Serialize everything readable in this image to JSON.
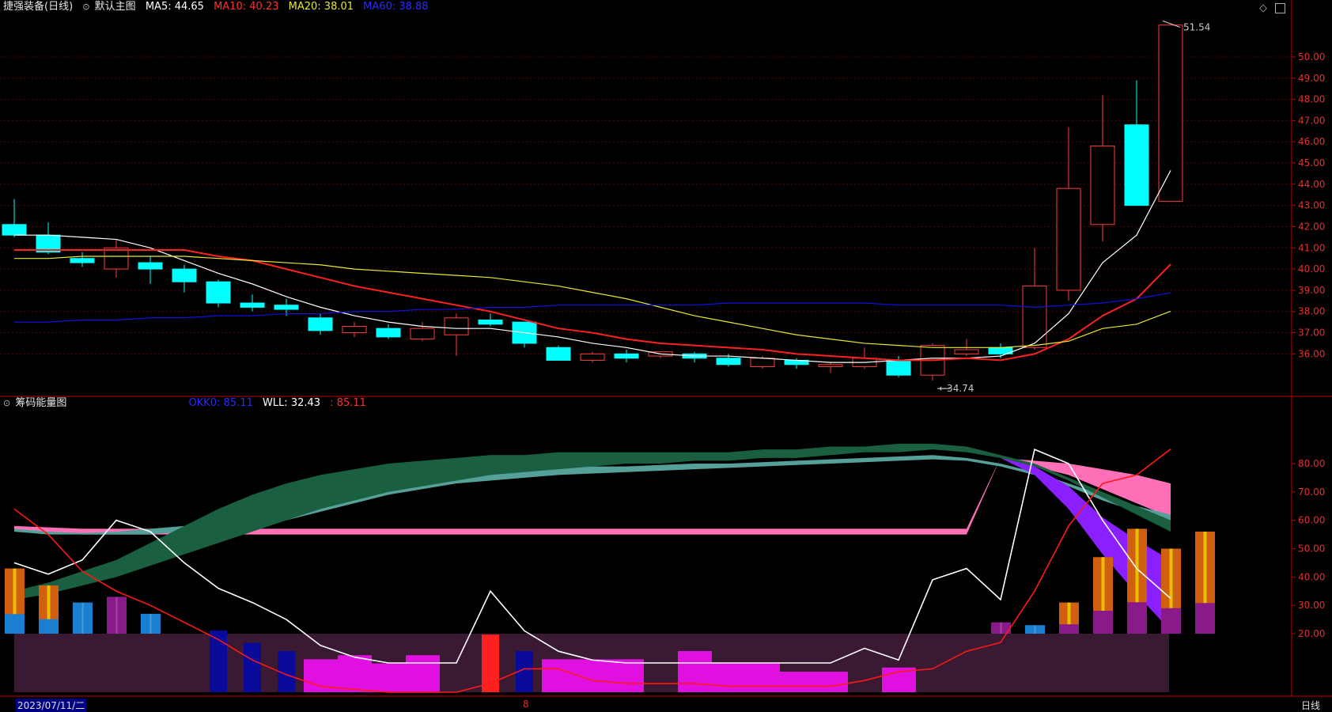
{
  "header_main": {
    "stock": "捷强装备",
    "period": "(日线)",
    "template": "默认主图",
    "ma5_label": "MA5:",
    "ma5_val": "44.65",
    "ma10_label": "MA10:",
    "ma10_val": "40.23",
    "ma20_label": "MA20:",
    "ma20_val": "38.01",
    "ma60_label": "MA60:",
    "ma60_val": "38.88"
  },
  "header_sub": {
    "title": "筹码能量图",
    "okk_label": "OKK0:",
    "okk_val": "85.11",
    "wll_label": "WLL:",
    "wll_val": "32.43",
    "extra_val": ": 85.11"
  },
  "footer": {
    "date": "2023/07/11/二",
    "marker": "8",
    "period_button": "日线"
  },
  "colors": {
    "up": "#ff3b3b",
    "down": "#00ffff",
    "ma5": "#ffffff",
    "ma10": "#ff2020",
    "ma20": "#e8e830",
    "ma60": "#1010e0",
    "axis": "#c00000",
    "band_dark": "#1a6040",
    "band_light": "#55a098",
    "purple": "#8a20ff",
    "pink": "#ff70b8"
  },
  "chart_data": [
    {
      "type": "candlestick",
      "title": "默认主图",
      "y_ticks": [
        "36.00",
        "37.00",
        "38.00",
        "39.00",
        "40.00",
        "41.00",
        "42.00",
        "43.00",
        "44.00",
        "45.00",
        "46.00",
        "47.00",
        "48.00",
        "49.00",
        "50.00"
      ],
      "ylim": [
        34.0,
        51.9
      ],
      "annotations": {
        "high": "51.54",
        "low": "34.74"
      },
      "candles": [
        {
          "o": 42.1,
          "c": 41.6,
          "h": 43.3,
          "l": 41.5
        },
        {
          "o": 41.6,
          "c": 40.8,
          "h": 42.2,
          "l": 40.7
        },
        {
          "o": 40.5,
          "c": 40.3,
          "h": 40.8,
          "l": 40.1
        },
        {
          "o": 40.0,
          "c": 41.0,
          "h": 41.4,
          "l": 39.6
        },
        {
          "o": 40.3,
          "c": 40.0,
          "h": 40.6,
          "l": 39.3
        },
        {
          "o": 40.0,
          "c": 39.4,
          "h": 40.2,
          "l": 38.9
        },
        {
          "o": 39.4,
          "c": 38.4,
          "h": 39.5,
          "l": 38.2
        },
        {
          "o": 38.4,
          "c": 38.2,
          "h": 38.8,
          "l": 38.0
        },
        {
          "o": 38.3,
          "c": 38.1,
          "h": 38.6,
          "l": 37.8
        },
        {
          "o": 37.7,
          "c": 37.1,
          "h": 37.9,
          "l": 36.9
        },
        {
          "o": 37.0,
          "c": 37.3,
          "h": 37.5,
          "l": 36.8
        },
        {
          "o": 37.2,
          "c": 36.8,
          "h": 37.4,
          "l": 36.7
        },
        {
          "o": 36.7,
          "c": 37.2,
          "h": 37.5,
          "l": 36.6
        },
        {
          "o": 36.9,
          "c": 37.7,
          "h": 37.9,
          "l": 35.9
        },
        {
          "o": 37.6,
          "c": 37.4,
          "h": 37.9,
          "l": 37.3
        },
        {
          "o": 37.5,
          "c": 36.5,
          "h": 37.5,
          "l": 36.3
        },
        {
          "o": 36.3,
          "c": 35.7,
          "h": 36.4,
          "l": 35.7
        },
        {
          "o": 35.7,
          "c": 36.0,
          "h": 36.1,
          "l": 35.6
        },
        {
          "o": 36.0,
          "c": 35.8,
          "h": 36.2,
          "l": 35.6
        },
        {
          "o": 35.9,
          "c": 36.1,
          "h": 36.1,
          "l": 35.8
        },
        {
          "o": 36.0,
          "c": 35.8,
          "h": 36.1,
          "l": 35.6
        },
        {
          "o": 35.8,
          "c": 35.5,
          "h": 36.0,
          "l": 35.4
        },
        {
          "o": 35.4,
          "c": 35.8,
          "h": 35.9,
          "l": 35.3
        },
        {
          "o": 35.7,
          "c": 35.5,
          "h": 35.8,
          "l": 35.3
        },
        {
          "o": 35.4,
          "c": 35.5,
          "h": 35.6,
          "l": 35.1
        },
        {
          "o": 35.4,
          "c": 35.8,
          "h": 36.3,
          "l": 35.3
        },
        {
          "o": 35.7,
          "c": 35.0,
          "h": 35.9,
          "l": 34.9
        },
        {
          "o": 35.0,
          "c": 36.4,
          "h": 36.5,
          "l": 34.74
        },
        {
          "o": 36.0,
          "c": 36.2,
          "h": 36.7,
          "l": 35.9
        },
        {
          "o": 36.3,
          "c": 36.0,
          "h": 36.5,
          "l": 35.8
        },
        {
          "o": 36.3,
          "c": 39.2,
          "h": 41.0,
          "l": 36.2
        },
        {
          "o": 39.0,
          "c": 43.8,
          "h": 46.7,
          "l": 38.5
        },
        {
          "o": 42.1,
          "c": 45.8,
          "h": 48.2,
          "l": 41.3
        },
        {
          "o": 46.8,
          "c": 43.0,
          "h": 48.9,
          "l": 43.0
        },
        {
          "o": 43.2,
          "c": 51.5,
          "h": 51.54,
          "l": 43.2
        }
      ],
      "series": [
        {
          "name": "MA5",
          "values": [
            41.6,
            41.6,
            41.5,
            41.4,
            41.0,
            40.4,
            39.8,
            39.3,
            38.7,
            38.2,
            37.8,
            37.5,
            37.3,
            37.2,
            37.2,
            37.0,
            36.8,
            36.5,
            36.3,
            36.0,
            35.9,
            35.9,
            35.8,
            35.7,
            35.6,
            35.6,
            35.7,
            35.8,
            35.8,
            35.9,
            36.5,
            37.9,
            40.3,
            41.6,
            44.65
          ]
        },
        {
          "name": "MA10",
          "values": [
            40.9,
            40.9,
            40.9,
            40.9,
            40.9,
            40.9,
            40.6,
            40.4,
            40.0,
            39.6,
            39.2,
            38.9,
            38.6,
            38.3,
            38.0,
            37.6,
            37.2,
            37.0,
            36.7,
            36.5,
            36.4,
            36.3,
            36.2,
            36.0,
            35.9,
            35.8,
            35.7,
            35.7,
            35.8,
            35.7,
            36.0,
            36.7,
            37.8,
            38.6,
            40.23
          ]
        },
        {
          "name": "MA20",
          "values": [
            40.5,
            40.5,
            40.6,
            40.6,
            40.6,
            40.6,
            40.5,
            40.4,
            40.3,
            40.2,
            40.0,
            39.9,
            39.8,
            39.7,
            39.6,
            39.4,
            39.2,
            38.9,
            38.6,
            38.2,
            37.8,
            37.5,
            37.2,
            36.9,
            36.7,
            36.5,
            36.4,
            36.3,
            36.3,
            36.3,
            36.4,
            36.6,
            37.2,
            37.4,
            38.01
          ]
        },
        {
          "name": "MA60",
          "values": [
            37.5,
            37.5,
            37.6,
            37.6,
            37.7,
            37.7,
            37.8,
            37.8,
            37.9,
            37.9,
            38.0,
            38.0,
            38.1,
            38.1,
            38.2,
            38.2,
            38.3,
            38.3,
            38.3,
            38.3,
            38.3,
            38.4,
            38.4,
            38.4,
            38.4,
            38.4,
            38.3,
            38.3,
            38.3,
            38.3,
            38.2,
            38.3,
            38.4,
            38.6,
            38.88
          ]
        }
      ]
    },
    {
      "type": "area",
      "title": "筹码能量图",
      "y_ticks": [
        "20.00",
        "30.00",
        "40.00",
        "50.00",
        "60.00",
        "70.00",
        "80.00"
      ],
      "ylim": [
        0,
        100
      ],
      "dark_band": {
        "upper": [
          35,
          38,
          42,
          46,
          52,
          58,
          64,
          69,
          73,
          76,
          78,
          80,
          81,
          82,
          83,
          83,
          84,
          84,
          84,
          84,
          84,
          84,
          85,
          85,
          86,
          86,
          87,
          87,
          86,
          83,
          80,
          75,
          70,
          65,
          60
        ],
        "lower": [
          32,
          34,
          37,
          40,
          44,
          48,
          52,
          56,
          60,
          64,
          67,
          70,
          72,
          74,
          76,
          77,
          78,
          79,
          80,
          80,
          81,
          81,
          82,
          82,
          83,
          84,
          84,
          85,
          84,
          82,
          79,
          74,
          68,
          62,
          56
        ]
      },
      "light_band": {
        "upper": [
          57,
          56,
          55.5,
          56,
          57,
          58,
          60,
          62,
          65,
          68,
          71,
          73,
          75,
          76,
          77,
          78,
          78.5,
          79,
          79,
          79.5,
          80,
          80,
          80.5,
          81,
          81.5,
          82,
          82.5,
          83,
          82,
          80,
          77,
          73,
          69,
          65,
          62
        ],
        "lower": [
          56,
          55,
          55,
          55,
          55,
          56,
          57,
          58,
          60,
          63,
          66,
          69,
          71,
          73,
          74,
          75,
          76,
          76.5,
          77,
          77.5,
          78,
          78.5,
          79,
          79.5,
          80,
          80.5,
          81,
          81.5,
          81,
          79,
          76,
          72,
          67,
          63,
          60
        ]
      },
      "purple_band": {
        "upper": [
          null,
          null,
          null,
          null,
          null,
          null,
          null,
          null,
          null,
          null,
          null,
          null,
          null,
          null,
          null,
          null,
          null,
          null,
          null,
          null,
          null,
          null,
          null,
          null,
          null,
          null,
          null,
          null,
          null,
          82,
          79,
          72,
          61,
          53,
          46
        ],
        "lower": [
          null,
          null,
          null,
          null,
          null,
          null,
          null,
          null,
          null,
          null,
          null,
          null,
          null,
          null,
          null,
          null,
          null,
          null,
          null,
          null,
          null,
          null,
          null,
          null,
          null,
          null,
          null,
          null,
          null,
          82,
          76,
          64,
          48,
          34,
          21
        ]
      },
      "pink_band": {
        "upper": [
          58,
          57.5,
          57,
          57,
          57,
          57,
          57,
          57,
          57,
          57,
          57,
          57,
          57,
          57,
          57,
          57,
          57,
          57,
          57,
          57,
          57,
          57,
          57,
          57,
          57,
          57,
          57,
          57,
          57,
          82,
          81,
          80,
          78,
          76,
          73
        ],
        "lower": [
          56,
          55.5,
          55,
          55,
          55,
          55,
          55,
          55,
          55,
          55,
          55,
          55,
          55,
          55,
          55,
          55,
          55,
          55,
          55,
          55,
          55,
          55,
          55,
          55,
          55,
          55,
          55,
          55,
          55,
          82,
          79,
          76,
          71,
          66,
          61
        ]
      },
      "series": [
        {
          "name": "WLL",
          "values": [
            45,
            41,
            46,
            60,
            56,
            45,
            36,
            31,
            25,
            16,
            12,
            10,
            10,
            10,
            35,
            21,
            14,
            11,
            10,
            10,
            10,
            10,
            10,
            10,
            10,
            15,
            11,
            39,
            43,
            32,
            85,
            80,
            60,
            43,
            32.43
          ]
        },
        {
          "name": "OKK0",
          "values": [
            64,
            55,
            42,
            35,
            30,
            24,
            18,
            11,
            6,
            2,
            1,
            0,
            0,
            0,
            3,
            8,
            8,
            4,
            3,
            3,
            3,
            2,
            2,
            2,
            2,
            4,
            7,
            8,
            14,
            17,
            35,
            58,
            73,
            76,
            85.11
          ]
        }
      ],
      "bars": {
        "top": [
          43,
          37,
          31,
          33,
          27,
          20,
          0,
          0,
          0,
          0,
          0,
          0,
          0,
          0,
          30,
          0,
          0,
          0,
          0,
          30,
          0,
          0,
          0,
          0,
          0,
          0,
          30,
          0,
          30,
          24,
          23,
          31,
          47,
          57,
          50,
          56
        ],
        "kinds": [
          "mix",
          "mix",
          "blue",
          "purple",
          "blue",
          "none",
          "none",
          "none",
          "none",
          "none",
          "none",
          "none",
          "none",
          "red",
          "none",
          "none",
          "none",
          "none",
          "red",
          "none",
          "none",
          "none",
          "none",
          "none",
          "none",
          "red",
          "none",
          "red",
          "none",
          "purple",
          "blue",
          "mix",
          "mix",
          "mix",
          "mix",
          "mix"
        ]
      },
      "lower_bars": {
        "kind": [
          "none",
          "none",
          "none",
          "none",
          "none",
          "none",
          "navy",
          "navy",
          "navy",
          "magenta",
          "magenta",
          "magenta",
          "magenta",
          "red",
          "red",
          "navy",
          "magenta",
          "magenta",
          "magenta",
          "red",
          "magenta",
          "magenta",
          "magenta",
          "magenta",
          "magenta",
          "red",
          "magenta",
          "red",
          "none",
          "none",
          "none",
          "none",
          "none",
          "none",
          "none"
        ],
        "height": [
          0,
          0,
          0,
          0,
          0,
          0,
          15,
          12,
          10,
          8,
          9,
          7,
          9,
          0,
          14,
          10,
          8,
          8,
          8,
          0,
          10,
          7,
          7,
          5,
          5,
          0,
          6,
          0,
          0,
          0,
          0,
          0,
          0,
          0,
          0
        ]
      }
    }
  ]
}
